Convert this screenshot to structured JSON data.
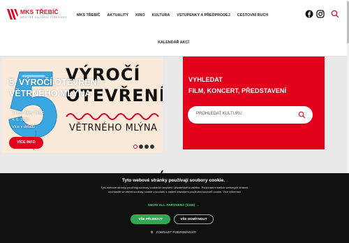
{
  "header": {
    "logo": {
      "name": "MKS TŘEBÍČ",
      "subtitle": "MĚSTSKÉ KULTURNÍ STŘEDISKO"
    },
    "nav": [
      "MKS Třebíč",
      "Aktuality",
      "Kino",
      "Kultura",
      "Vstupenky a předprodej",
      "Cestovní ruch"
    ],
    "nav_row2": "Kalendář akcí",
    "icons": [
      "facebook-icon",
      "instagram-icon",
      "search-icon"
    ]
  },
  "hero": {
    "poster": {
      "line1": "VÝROČÍ",
      "line2": "OTEVŘENÍ",
      "line3": "VĚTRNÉHO MLÝNA",
      "balloon": "5"
    },
    "overlay_title_line1": "5. VÝROČÍ OTEVŘENÍ",
    "overlay_title_line2": "VĚTRNÉHO MLÝNA",
    "overlay_meta1": "Větrný mlýn Třebíč",
    "overlay_meta2": "4. 6. 2026",
    "overlay_meta3": "Více v detailu",
    "button": "VÍCE INFO",
    "slides": 4,
    "active_slide": 1
  },
  "search": {
    "heading_line1": "VYHLEDAT",
    "heading_line2": "FILM, KONCERT, PŘEDSTAVENÍ",
    "placeholder": "PROHLEDAT KULTURU"
  },
  "cookie": {
    "title": "Tyto webové stránky používají soubory cookie.",
    "description": "Tyto webové stránky používají soubory cookie ke zlepšení uživatelského zážitku. Používáním našich webových stránek souhlasíte se všemi soubory cookie v souladu s našimi zásadami používání souborů cookie. Více informací",
    "partners": "SHOW ALL PARTNERS (1166) →",
    "accept": "VŠE PŘIJMOUT",
    "reject": "VŠE ODMÍTNOUT",
    "details": "ZOBRAZIT PODROBNOSTI"
  },
  "colors": {
    "brand_red": "#e2001a",
    "accept_green": "#33a852",
    "cookie_bg": "#111111"
  }
}
